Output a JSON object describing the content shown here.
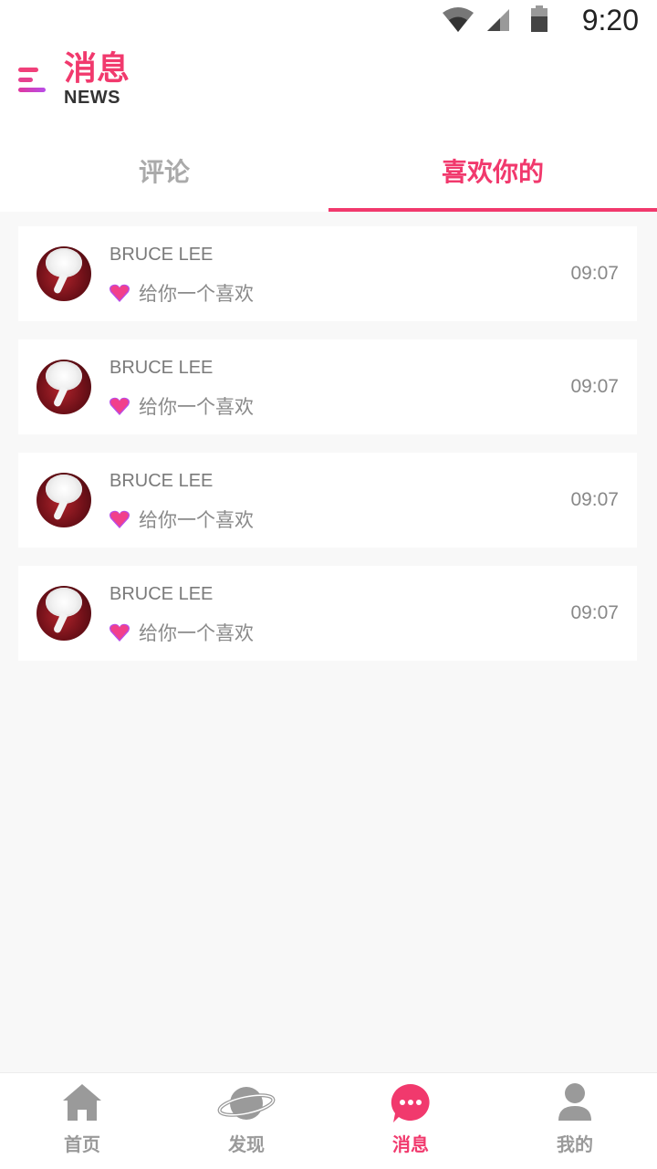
{
  "status_bar": {
    "time": "9:20"
  },
  "header": {
    "title": "消息",
    "subtitle": "NEWS"
  },
  "tabs": [
    {
      "label": "评论",
      "active": false
    },
    {
      "label": "喜欢你的",
      "active": true
    }
  ],
  "messages": [
    {
      "name": "BRUCE LEE",
      "text": "给你一个喜欢",
      "time": "09:07"
    },
    {
      "name": "BRUCE LEE",
      "text": "给你一个喜欢",
      "time": "09:07"
    },
    {
      "name": "BRUCE LEE",
      "text": "给你一个喜欢",
      "time": "09:07"
    },
    {
      "name": "BRUCE LEE",
      "text": "给你一个喜欢",
      "time": "09:07"
    }
  ],
  "bottom_nav": [
    {
      "label": "首页",
      "icon": "home-icon",
      "active": false
    },
    {
      "label": "发现",
      "icon": "planet-icon",
      "active": false
    },
    {
      "label": "消息",
      "icon": "chat-bubble-icon",
      "active": true
    },
    {
      "label": "我的",
      "icon": "person-icon",
      "active": false
    }
  ],
  "colors": {
    "accent": "#f1396d",
    "inactive": "#9a9a9a",
    "background": "#f8f8f8"
  }
}
